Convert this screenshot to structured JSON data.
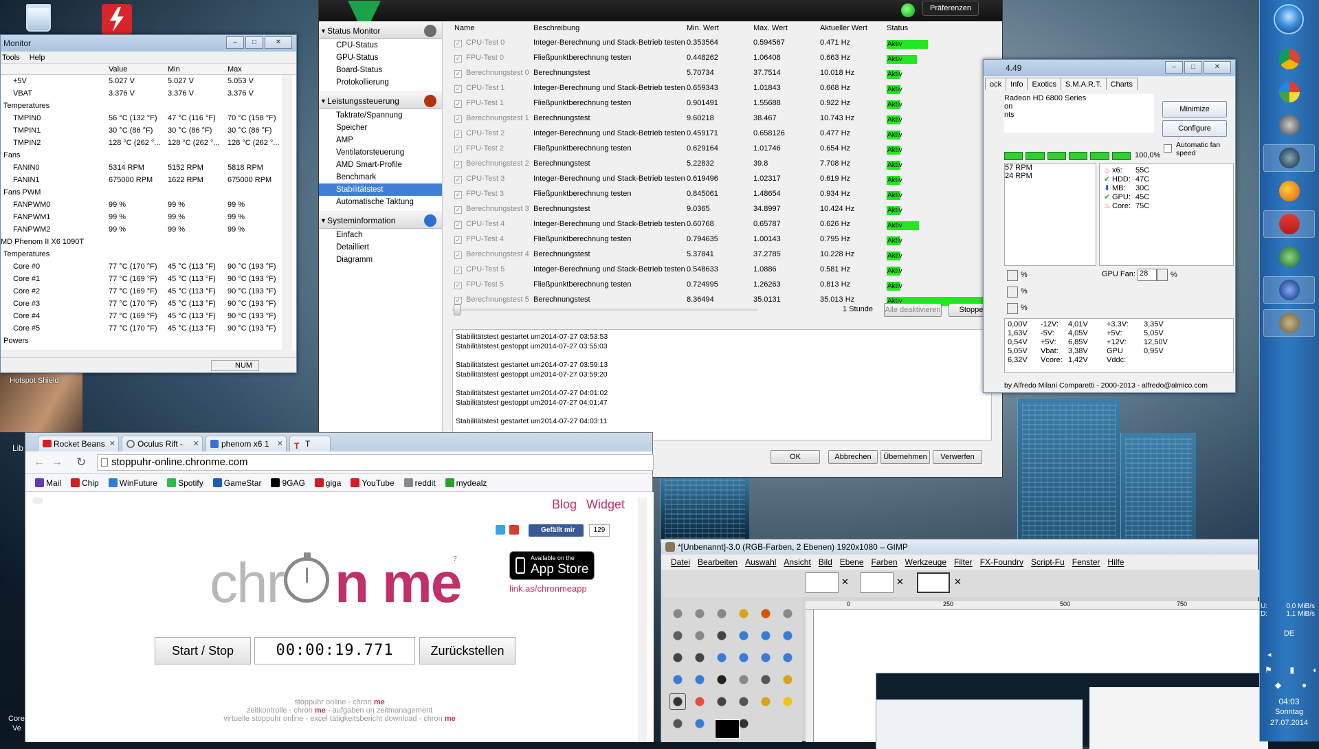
{
  "desktop": {
    "recycle_bin_label": "",
    "hotspot_label": "Hotspot Shield",
    "left_edge_text": [
      "Lib",
      "Core",
      "Ve"
    ]
  },
  "hwmonitor": {
    "title": "Monitor",
    "menu": [
      "Tools",
      "Help"
    ],
    "columns": [
      "",
      "Value",
      "Min",
      "Max"
    ],
    "rows": [
      [
        "+5V",
        "5.027 V",
        "5.027 V",
        "5.053 V"
      ],
      [
        "VBAT",
        "3.376 V",
        "3.376 V",
        "3.376 V"
      ],
      [
        "Temperatures",
        "",
        "",
        ""
      ],
      [
        "TMPIN0",
        "56 °C (132 °F)",
        "47 °C (116 °F)",
        "70 °C (158 °F)"
      ],
      [
        "TMPIN1",
        "30 °C (86 °F)",
        "30 °C (86 °F)",
        "30 °C (86 °F)"
      ],
      [
        "TMPIN2",
        "128 °C (262 °...",
        "128 °C (262 °...",
        "128 °C (262 °..."
      ],
      [
        "Fans",
        "",
        "",
        ""
      ],
      [
        "FANIN0",
        "5314 RPM",
        "5152 RPM",
        "5818 RPM"
      ],
      [
        "FANIN1",
        "675000 RPM",
        "1622 RPM",
        "675000 RPM"
      ],
      [
        "Fans PWM",
        "",
        "",
        ""
      ],
      [
        "FANPWM0",
        "99 %",
        "99 %",
        "99 %"
      ],
      [
        "FANPWM1",
        "99 %",
        "99 %",
        "99 %"
      ],
      [
        "FANPWM2",
        "99 %",
        "99 %",
        "99 %"
      ],
      [
        "MD Phenom II X6 1090T",
        "",
        "",
        ""
      ],
      [
        "Temperatures",
        "",
        "",
        ""
      ],
      [
        "Core #0",
        "77 °C (170 °F)",
        "45 °C (113 °F)",
        "90 °C (193 °F)"
      ],
      [
        "Core #1",
        "77 °C (169 °F)",
        "45 °C (113 °F)",
        "90 °C (193 °F)"
      ],
      [
        "Core #2",
        "77 °C (169 °F)",
        "45 °C (113 °F)",
        "90 °C (193 °F)"
      ],
      [
        "Core #3",
        "77 °C (170 °F)",
        "45 °C (113 °F)",
        "90 °C (193 °F)"
      ],
      [
        "Core #4",
        "77 °C (169 °F)",
        "45 °C (113 °F)",
        "90 °C (193 °F)"
      ],
      [
        "Core #5",
        "77 °C (170 °F)",
        "45 °C (113 °F)",
        "90 °C (193 °F)"
      ],
      [
        "Powers",
        "",
        "",
        ""
      ]
    ],
    "status": "NUM"
  },
  "amd": {
    "prefs_label": "Präferenzen",
    "sidebar": [
      {
        "head": "Status Monitor",
        "items": [
          "CPU-Status",
          "GPU-Status",
          "Board-Status",
          "Protokollierung"
        ]
      },
      {
        "head": "Leistungssteuerung",
        "items": [
          "Taktrate/Spannung",
          "Speicher",
          "AMP",
          "Ventilatorsteuerung",
          "AMD Smart-Profile",
          "Benchmark",
          "Stabilitätstest",
          "Automatische Taktung"
        ]
      },
      {
        "head": "Systeminformation",
        "items": [
          "Einfach",
          "Detailliert",
          "Diagramm"
        ]
      }
    ],
    "selected_item": "Stabilitätstest",
    "columns": [
      "Name",
      "Beschreibung",
      "Min. Wert",
      "Max. Wert",
      "Aktueller Wert",
      "Status"
    ],
    "rows": [
      {
        "name": "CPU-Test 0",
        "desc": "Integer-Berechnung und Stack-Betrieb testen",
        "min": "0.353564",
        "max": "0.594567",
        "cur": "0.471 Hz",
        "status": "Aktiv",
        "fill": 0.4
      },
      {
        "name": "FPU-Test 0",
        "desc": "Fließpunktberechnung testen",
        "min": "0.448262",
        "max": "1.06408",
        "cur": "0.663 Hz",
        "status": "Aktiv",
        "fill": 0.29
      },
      {
        "name": "Berechnungstest 0",
        "desc": "Berechnungstest",
        "min": "5.70734",
        "max": "37.7514",
        "cur": "10.018 Hz",
        "status": "Aktiv",
        "fill": 0.13
      },
      {
        "name": "CPU-Test 1",
        "desc": "Integer-Berechnung und Stack-Betrieb testen",
        "min": "0.659343",
        "max": "1.01843",
        "cur": "0.668 Hz",
        "status": "Aktiv",
        "fill": 0.13
      },
      {
        "name": "FPU-Test 1",
        "desc": "Fließpunktberechnung testen",
        "min": "0.901491",
        "max": "1.55688",
        "cur": "0.922 Hz",
        "status": "Aktiv",
        "fill": 0.13
      },
      {
        "name": "Berechnungstest 1",
        "desc": "Berechnungstest",
        "min": "9.60218",
        "max": "38.467",
        "cur": "10.743 Hz",
        "status": "Aktiv",
        "fill": 0.13
      },
      {
        "name": "CPU-Test 2",
        "desc": "Integer-Berechnung und Stack-Betrieb testen",
        "min": "0.459171",
        "max": "0.658126",
        "cur": "0.477 Hz",
        "status": "Aktiv",
        "fill": 0.13
      },
      {
        "name": "FPU-Test 2",
        "desc": "Fließpunktberechnung testen",
        "min": "0.629164",
        "max": "1.01746",
        "cur": "0.654 Hz",
        "status": "Aktiv",
        "fill": 0.13
      },
      {
        "name": "Berechnungstest 2",
        "desc": "Berechnungstest",
        "min": "5.22832",
        "max": "39.8",
        "cur": "7.708 Hz",
        "status": "Aktiv",
        "fill": 0.13
      },
      {
        "name": "CPU-Test 3",
        "desc": "Integer-Berechnung und Stack-Betrieb testen",
        "min": "0.619496",
        "max": "1.02317",
        "cur": "0.619 Hz",
        "status": "Aktiv",
        "fill": 0.13
      },
      {
        "name": "FPU-Test 3",
        "desc": "Fließpunktberechnung testen",
        "min": "0.845061",
        "max": "1.48654",
        "cur": "0.934 Hz",
        "status": "Aktiv",
        "fill": 0.13
      },
      {
        "name": "Berechnungstest 3",
        "desc": "Berechnungstest",
        "min": "9.0365",
        "max": "34.8997",
        "cur": "10.424 Hz",
        "status": "Aktiv",
        "fill": 0.13
      },
      {
        "name": "CPU-Test 4",
        "desc": "Integer-Berechnung und Stack-Betrieb testen",
        "min": "0.60768",
        "max": "0.65787",
        "cur": "0.626 Hz",
        "status": "Aktiv",
        "fill": 0.31
      },
      {
        "name": "FPU-Test 4",
        "desc": "Fließpunktberechnung testen",
        "min": "0.794635",
        "max": "1.00143",
        "cur": "0.795 Hz",
        "status": "Aktiv",
        "fill": 0.13
      },
      {
        "name": "Berechnungstest 4",
        "desc": "Berechnungstest",
        "min": "5.37841",
        "max": "37.2785",
        "cur": "10.228 Hz",
        "status": "Aktiv",
        "fill": 0.13
      },
      {
        "name": "CPU-Test 5",
        "desc": "Integer-Berechnung und Stack-Betrieb testen",
        "min": "0.548633",
        "max": "1.0886",
        "cur": "0.581 Hz",
        "status": "Aktiv",
        "fill": 0.13
      },
      {
        "name": "FPU-Test 5",
        "desc": "Fließpunktberechnung testen",
        "min": "0.724995",
        "max": "1.26263",
        "cur": "0.813 Hz",
        "status": "Aktiv",
        "fill": 0.13
      },
      {
        "name": "Berechnungstest 5",
        "desc": "Berechnungstest",
        "min": "8.36494",
        "max": "35.0131",
        "cur": "35.013 Hz",
        "status": "Aktiv",
        "fill": 1.0
      }
    ],
    "duration": "1 Stunde",
    "btn_deactivate": "Alle deaktivieren",
    "btn_stop": "Stoppen",
    "log": [
      "Stabilitätstest gestartet um2014-07-27 03:53:53",
      "Stabilitätstest gestoppt um2014-07-27 03:55:03",
      "",
      "Stabilitätstest gestartet um2014-07-27 03:59:13",
      "Stabilitätstest gestoppt um2014-07-27 03:59:20",
      "",
      "Stabilitätstest gestartet um2014-07-27 04:01:02",
      "Stabilitätstest gestoppt um2014-07-27 04:01:47",
      "",
      "Stabilitätstest gestartet um2014-07-27 04:03:11"
    ],
    "footer_buttons": [
      "OK",
      "Abbrechen",
      "Übernehmen",
      "Verwerfen"
    ]
  },
  "speedfan": {
    "title": "4.49",
    "tabs": [
      "ock",
      "Info",
      "Exotics",
      "S.M.A.R.T.",
      "Charts"
    ],
    "list_lines": [
      "Radeon HD 6800 Series",
      "on",
      "nts"
    ],
    "btn_minimize": "Minimize",
    "btn_configure": "Configure",
    "auto_fan_label": "Automatic fan speed",
    "progress_label": "100,0%",
    "fans": [
      "57 RPM",
      "24 RPM"
    ],
    "temps": [
      {
        "icon": "flame",
        "label": "x6:",
        "value": "55C"
      },
      {
        "icon": "check",
        "label": "HDD:",
        "value": "47C"
      },
      {
        "icon": "down",
        "label": "MB:",
        "value": "30C"
      },
      {
        "icon": "check",
        "label": "GPU:",
        "value": "45C"
      },
      {
        "icon": "flame",
        "label": "Core:",
        "value": "75C"
      }
    ],
    "gpu_fan_label": "GPU Fan:",
    "gpu_fan_value": "28",
    "pct_symbol": "%",
    "voltages": [
      [
        "0,00V",
        "-12V:",
        "4,01V",
        "+3.3V:",
        "3,35V"
      ],
      [
        "1,63V",
        "-5V:",
        "4,05V",
        "+5V:",
        "5,05V"
      ],
      [
        "0,54V",
        "+5V:",
        "6,85V",
        "+12V:",
        "12,50V"
      ],
      [
        "5,05V",
        "Vbat:",
        "3,38V",
        "GPU Vddc:",
        "0,95V"
      ],
      [
        "6,32V",
        "Vcore:",
        "1,42V",
        "",
        ""
      ]
    ],
    "credits": "by Alfredo Milani Comparetti - 2000-2013 - alfredo@almico.com"
  },
  "browser": {
    "tabs": [
      "Rocket Beans",
      "Oculus Rift -",
      "phenom x6 1",
      "T"
    ],
    "url": "stoppuhr-online.chronme.com",
    "bookmarks": [
      "Mail",
      "Chip",
      "WinFuture",
      "Spotify",
      "GameStar",
      "9GAG",
      "giga",
      "YouTube",
      "reddit",
      "mydealz"
    ],
    "page": {
      "blog": "Blog",
      "widget": "Widget",
      "like_label": "Gefällt mir",
      "like_count": "129",
      "logo_left": "chr",
      "logo_right": "n me",
      "logo_sup": "?",
      "appstore_small": "Available on the",
      "appstore_big": "App Store",
      "appstore_link": "link.as/chronmeapp",
      "btn_startstop": "Start / Stop",
      "timer": "00:00:19.771",
      "btn_reset": "Zurückstellen",
      "footer": [
        [
          "stoppuhr online - chron ",
          "me"
        ],
        [
          "zeitkontrolle - chron ",
          "me",
          " - aufgaben un zeitmanagement"
        ],
        [
          "virtuelle stoppuhr online - excel tätigkeitsbericht download - chron ",
          "me"
        ]
      ]
    }
  },
  "gimp": {
    "title": "*[Unbenannt]-3.0 (RGB-Farben, 2 Ebenen) 1920x1080 – GIMP",
    "menu": [
      "Datei",
      "Bearbeiten",
      "Auswahl",
      "Ansicht",
      "Bild",
      "Ebene",
      "Farben",
      "Werkzeuge",
      "Filter",
      "FX-Foundry",
      "Script-Fu",
      "Fenster",
      "Hilfe"
    ],
    "ruler": [
      "0",
      "250",
      "500",
      "750"
    ]
  },
  "tray": {
    "net_up": "0,0 MiB/s",
    "net_down": "1,1 MiB/s",
    "net_prefix_up": "U:",
    "net_prefix_down": "D:",
    "lang": "DE",
    "time": "04:03",
    "day": "Sonntag",
    "date": "27.07.2014"
  },
  "colors": {
    "accent_green": "#23e81f",
    "chronme_pink": "#c0306a",
    "selection_blue": "#3f7fd6"
  }
}
